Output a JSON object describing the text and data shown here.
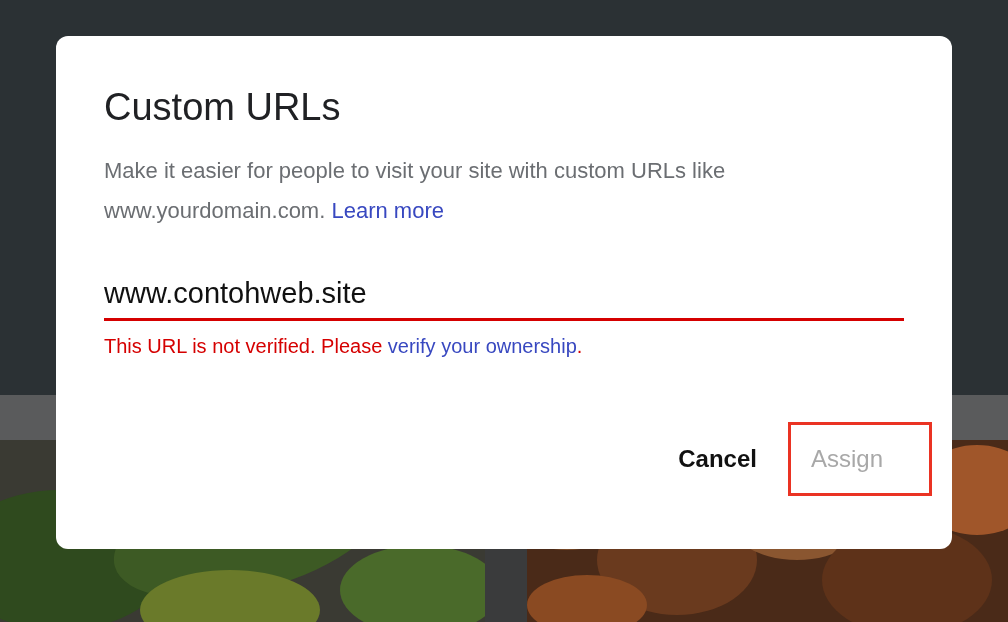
{
  "dialog": {
    "title": "Custom URLs",
    "description": "Make it easier for people to visit your site with custom URLs like www.yourdomain.com.",
    "learn_more_link": "Learn more",
    "url_field": {
      "value": "www.contohweb.site",
      "error": true
    },
    "error_text": "This URL is not verified. Please",
    "error_link": "verify your ownership",
    "error_end": ".",
    "buttons": [
      {
        "label": "Cancel",
        "disabled": false,
        "highlighted": false
      },
      {
        "label": "Assign",
        "disabled": true,
        "highlighted": true
      }
    ]
  }
}
